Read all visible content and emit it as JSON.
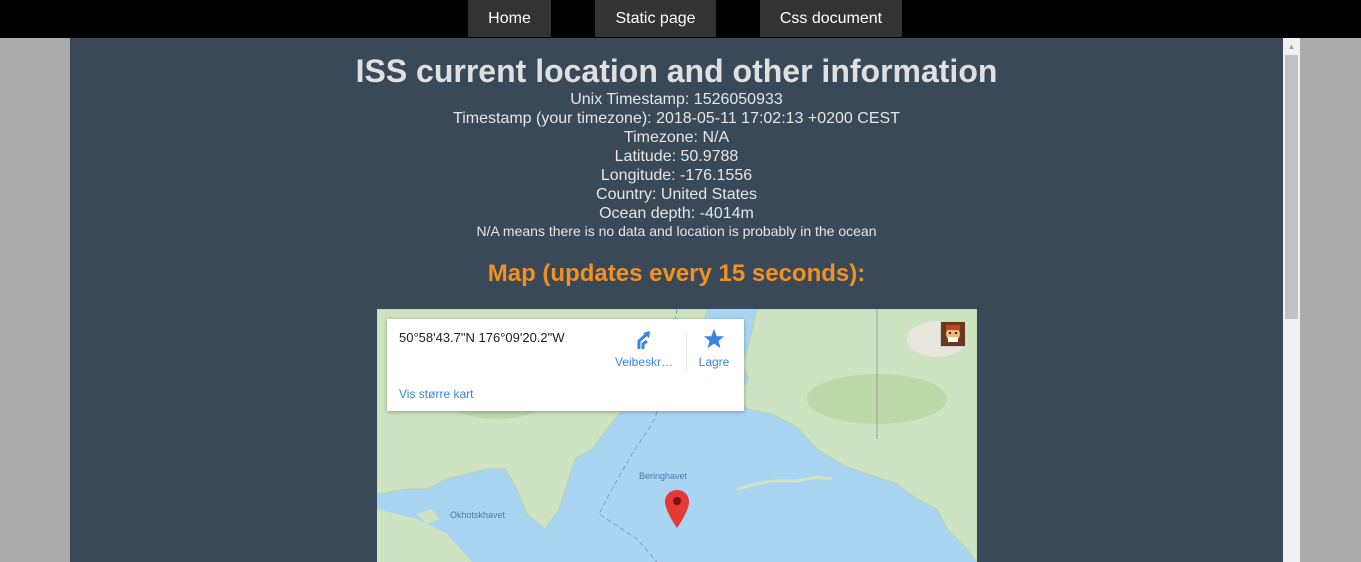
{
  "nav": {
    "home": "Home",
    "static_page": "Static page",
    "css_document": "Css document"
  },
  "page": {
    "title": "ISS current location and other information",
    "unix_timestamp": "Unix Timestamp: 1526050933",
    "timestamp_local": "Timestamp (your timezone): 2018-05-11 17:02:13 +0200 CEST",
    "timezone": "Timezone: N/A",
    "latitude": "Latitude: 50.9788",
    "longitude": "Longitude: -176.1556",
    "country": "Country: United States",
    "ocean_depth": "Ocean depth: -4014m",
    "note": "N/A means there is no data and location is probably in the ocean",
    "map_heading": "Map (updates every 15 seconds):"
  },
  "map": {
    "coordinates": "50°58'43.7\"N 176°09'20.2\"W",
    "directions_label": "Veibeskr…",
    "save_label": "Lagre",
    "larger_map_link": "Vis større kart",
    "label_bering": "Beringhavet",
    "label_okhotsk": "Okhotskhavet",
    "marker_icon": "map-pin-icon",
    "directions_icon": "directions-icon",
    "save_icon": "star-icon"
  },
  "colors": {
    "panel_bg": "#3a4957",
    "accent_orange": "#f39021",
    "link_blue": "#3a84df",
    "marker_red": "#e53935",
    "water": "#a9d5f3",
    "land": "#cde3c1"
  }
}
